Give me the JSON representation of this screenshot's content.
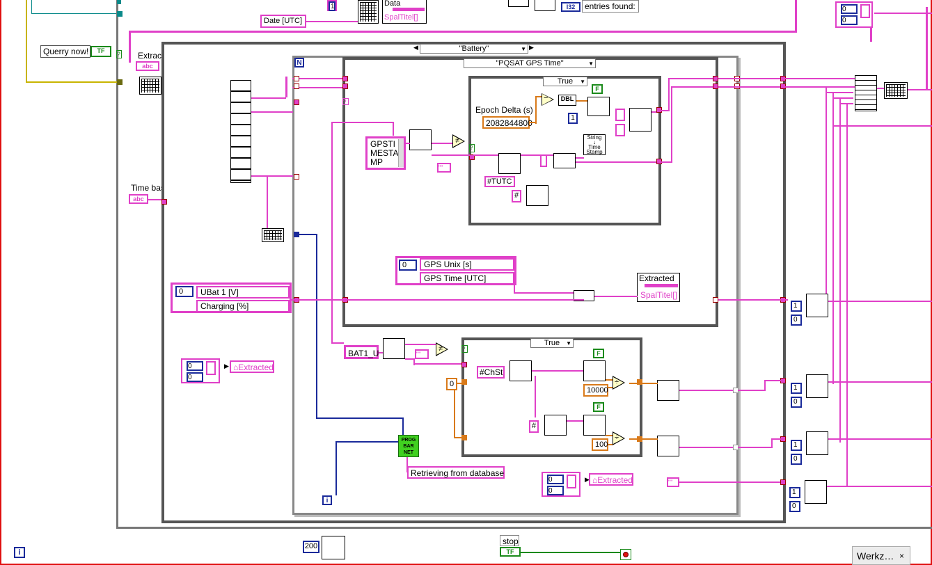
{
  "top": {
    "data_label": "Data",
    "spaltitel_top": "SpalTitel[]",
    "date_utc": "Date [UTC]",
    "const_one_top": "1",
    "i32_badge": "I32",
    "entries_found": "entries found:",
    "tr_values": [
      "0",
      "0"
    ]
  },
  "left": {
    "querry_now": "Querry now!",
    "tf_badge": "TF",
    "extract_label": "Extract",
    "abc_badge": "abc",
    "time_base": "Time base"
  },
  "selectors": {
    "battery": "\"Battery\"",
    "pqsat": "\"PQSAT GPS Time\"",
    "true_top": "True",
    "true_bottom": "True"
  },
  "gps": {
    "listbox": "GPSTI\nMESTA\nMP",
    "epoch_label": "Epoch Delta (s)",
    "epoch_value": "2082844800",
    "dbl_badge": "DBL",
    "const_one": "1",
    "f_badge": "F",
    "tutc": "#TUTC",
    "hash": "#",
    "empty_string": "\"\"",
    "string_to_ts": "String\n↓\nTime\nStamp",
    "index_value": "0",
    "gps_unix": "GPS Unix [s]",
    "gps_time": "GPS Time [UTC]",
    "extracted_label": "Extracted",
    "spaltitel": "SpalTitel[]"
  },
  "battery": {
    "index_value": "0",
    "ubat": "UBat 1 [V]",
    "charging": "Charging [%]",
    "bat1_u": "BAT1_U",
    "empty_string": "\"\"",
    "chst": "#ChSt",
    "zero_const": "0",
    "hash": "#",
    "f_badge_1": "F",
    "f_badge_2": "F",
    "c10000": "10000",
    "c100": "100",
    "prog_bar": "PROG\nBAR\nNET",
    "retrieving": "Retrieving from database",
    "i_terminal": "i",
    "n_terminal": "N"
  },
  "extracted_clusters": {
    "left_values": [
      "0",
      "0"
    ],
    "left_label": "Extracted",
    "right_values": [
      "0",
      "0"
    ],
    "right_label": "Extracted",
    "empty_string": "\"\""
  },
  "right_column": {
    "pairs": [
      [
        "1",
        "0"
      ],
      [
        "1",
        "0"
      ],
      [
        "1",
        "0"
      ],
      [
        "1",
        "0"
      ]
    ]
  },
  "bottom": {
    "i_terminal": "i",
    "wait_ms": "200",
    "stop_label": "stop",
    "tf_badge": "TF",
    "taskbar_label": "Werkz…",
    "taskbar_close": "×"
  },
  "colors": {
    "string_wire": "#e040c8",
    "int_wire": "#1a2a9a",
    "dbl_wire": "#d97a1a",
    "bool_green": "#1a8a1a",
    "frame_gray": "#555555",
    "outer_red": "#e01010"
  }
}
